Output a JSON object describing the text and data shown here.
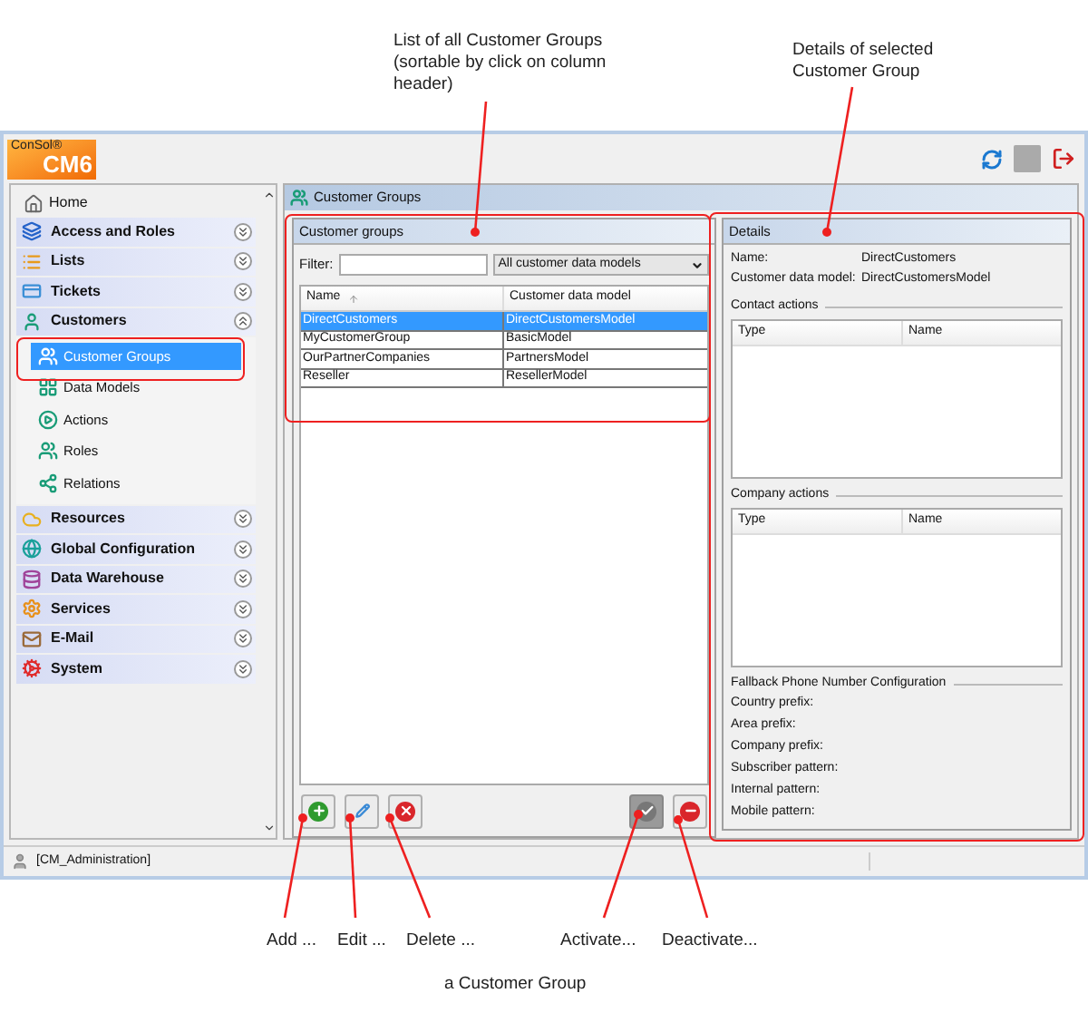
{
  "annotations": {
    "list_note": "List of all Customer Groups (sortable by click on column header)",
    "details_note": "Details of selected Customer Group",
    "button_notes": [
      "Add ...",
      "Edit ...",
      "Delete ...",
      "Activate...",
      "Deactivate..."
    ],
    "caption": "a Customer Group"
  },
  "logo": {
    "brand": "ConSol®",
    "product": "CM6"
  },
  "sidebar": {
    "home": "Home",
    "groups": [
      {
        "label": "Access and Roles",
        "kind": "access",
        "expanded": false
      },
      {
        "label": "Lists",
        "kind": "lists",
        "expanded": false
      },
      {
        "label": "Tickets",
        "kind": "tickets",
        "expanded": false
      },
      {
        "label": "Customers",
        "kind": "customers",
        "expanded": true,
        "children": [
          {
            "label": "Customer Groups",
            "kind": "groups",
            "selected": true
          },
          {
            "label": "Data Models",
            "kind": "models",
            "selected": false
          },
          {
            "label": "Actions",
            "kind": "actions",
            "selected": false
          },
          {
            "label": "Roles",
            "kind": "roles",
            "selected": false
          },
          {
            "label": "Relations",
            "kind": "relations",
            "selected": false
          }
        ]
      },
      {
        "label": "Resources",
        "kind": "resources",
        "expanded": false
      },
      {
        "label": "Global Configuration",
        "kind": "global",
        "expanded": false
      },
      {
        "label": "Data Warehouse",
        "kind": "warehouse",
        "expanded": false
      },
      {
        "label": "Services",
        "kind": "services",
        "expanded": false
      },
      {
        "label": "E-Mail",
        "kind": "email",
        "expanded": false
      },
      {
        "label": "System",
        "kind": "system",
        "expanded": false
      }
    ]
  },
  "main": {
    "title": "Customer Groups",
    "list": {
      "title": "Customer groups",
      "filter_label": "Filter:",
      "model_select": "All customer data models",
      "columns": [
        "Name",
        "Customer data model"
      ],
      "rows": [
        {
          "name": "DirectCustomers",
          "model": "DirectCustomersModel",
          "selected": true
        },
        {
          "name": "MyCustomerGroup",
          "model": "BasicModel",
          "selected": false
        },
        {
          "name": "OurPartnerCompanies",
          "model": "PartnersModel",
          "selected": false
        },
        {
          "name": "Reseller",
          "model": "ResellerModel",
          "selected": false
        }
      ],
      "buttons": [
        {
          "kind": "add",
          "disabled": false
        },
        {
          "kind": "edit",
          "disabled": false
        },
        {
          "kind": "delete",
          "disabled": false
        },
        {
          "kind": "activate",
          "disabled": true
        },
        {
          "kind": "deactivate",
          "disabled": false
        }
      ]
    },
    "details": {
      "title": "Details",
      "fields": [
        {
          "label": "Name:",
          "value": "DirectCustomers"
        },
        {
          "label": "Customer data model:",
          "value": "DirectCustomersModel"
        }
      ],
      "contact_actions": {
        "title": "Contact actions",
        "columns": [
          "Type",
          "Name"
        ]
      },
      "company_actions": {
        "title": "Company actions",
        "columns": [
          "Type",
          "Name"
        ]
      },
      "fallback": {
        "title": "Fallback Phone Number Configuration",
        "fields": [
          "Country prefix:",
          "Area prefix:",
          "Company prefix:",
          "Subscriber pattern:",
          "Internal pattern:",
          "Mobile pattern:"
        ]
      }
    }
  },
  "status_bar": {
    "user": "[CM_Administration]"
  }
}
